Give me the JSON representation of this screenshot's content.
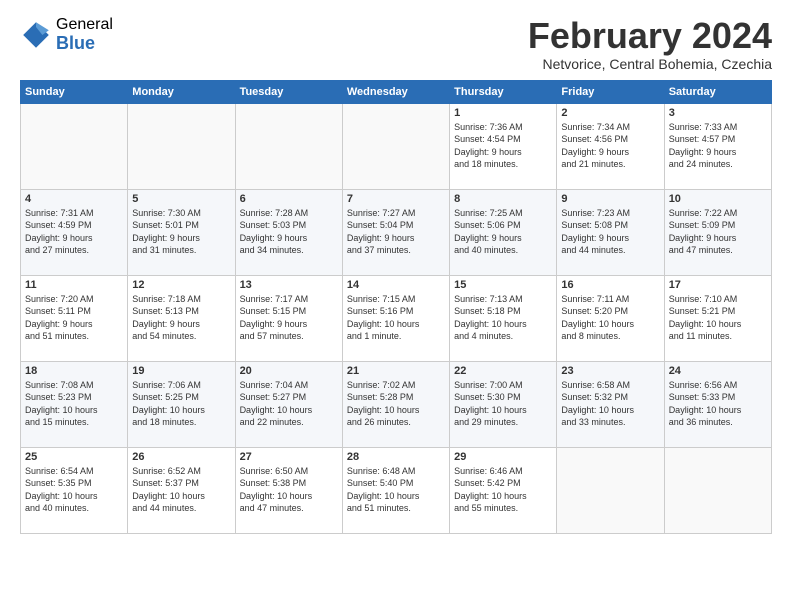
{
  "logo": {
    "general": "General",
    "blue": "Blue"
  },
  "title": "February 2024",
  "subtitle": "Netvorice, Central Bohemia, Czechia",
  "days_of_week": [
    "Sunday",
    "Monday",
    "Tuesday",
    "Wednesday",
    "Thursday",
    "Friday",
    "Saturday"
  ],
  "weeks": [
    [
      {
        "day": "",
        "content": ""
      },
      {
        "day": "",
        "content": ""
      },
      {
        "day": "",
        "content": ""
      },
      {
        "day": "",
        "content": ""
      },
      {
        "day": "1",
        "content": "Sunrise: 7:36 AM\nSunset: 4:54 PM\nDaylight: 9 hours\nand 18 minutes."
      },
      {
        "day": "2",
        "content": "Sunrise: 7:34 AM\nSunset: 4:56 PM\nDaylight: 9 hours\nand 21 minutes."
      },
      {
        "day": "3",
        "content": "Sunrise: 7:33 AM\nSunset: 4:57 PM\nDaylight: 9 hours\nand 24 minutes."
      }
    ],
    [
      {
        "day": "4",
        "content": "Sunrise: 7:31 AM\nSunset: 4:59 PM\nDaylight: 9 hours\nand 27 minutes."
      },
      {
        "day": "5",
        "content": "Sunrise: 7:30 AM\nSunset: 5:01 PM\nDaylight: 9 hours\nand 31 minutes."
      },
      {
        "day": "6",
        "content": "Sunrise: 7:28 AM\nSunset: 5:03 PM\nDaylight: 9 hours\nand 34 minutes."
      },
      {
        "day": "7",
        "content": "Sunrise: 7:27 AM\nSunset: 5:04 PM\nDaylight: 9 hours\nand 37 minutes."
      },
      {
        "day": "8",
        "content": "Sunrise: 7:25 AM\nSunset: 5:06 PM\nDaylight: 9 hours\nand 40 minutes."
      },
      {
        "day": "9",
        "content": "Sunrise: 7:23 AM\nSunset: 5:08 PM\nDaylight: 9 hours\nand 44 minutes."
      },
      {
        "day": "10",
        "content": "Sunrise: 7:22 AM\nSunset: 5:09 PM\nDaylight: 9 hours\nand 47 minutes."
      }
    ],
    [
      {
        "day": "11",
        "content": "Sunrise: 7:20 AM\nSunset: 5:11 PM\nDaylight: 9 hours\nand 51 minutes."
      },
      {
        "day": "12",
        "content": "Sunrise: 7:18 AM\nSunset: 5:13 PM\nDaylight: 9 hours\nand 54 minutes."
      },
      {
        "day": "13",
        "content": "Sunrise: 7:17 AM\nSunset: 5:15 PM\nDaylight: 9 hours\nand 57 minutes."
      },
      {
        "day": "14",
        "content": "Sunrise: 7:15 AM\nSunset: 5:16 PM\nDaylight: 10 hours\nand 1 minute."
      },
      {
        "day": "15",
        "content": "Sunrise: 7:13 AM\nSunset: 5:18 PM\nDaylight: 10 hours\nand 4 minutes."
      },
      {
        "day": "16",
        "content": "Sunrise: 7:11 AM\nSunset: 5:20 PM\nDaylight: 10 hours\nand 8 minutes."
      },
      {
        "day": "17",
        "content": "Sunrise: 7:10 AM\nSunset: 5:21 PM\nDaylight: 10 hours\nand 11 minutes."
      }
    ],
    [
      {
        "day": "18",
        "content": "Sunrise: 7:08 AM\nSunset: 5:23 PM\nDaylight: 10 hours\nand 15 minutes."
      },
      {
        "day": "19",
        "content": "Sunrise: 7:06 AM\nSunset: 5:25 PM\nDaylight: 10 hours\nand 18 minutes."
      },
      {
        "day": "20",
        "content": "Sunrise: 7:04 AM\nSunset: 5:27 PM\nDaylight: 10 hours\nand 22 minutes."
      },
      {
        "day": "21",
        "content": "Sunrise: 7:02 AM\nSunset: 5:28 PM\nDaylight: 10 hours\nand 26 minutes."
      },
      {
        "day": "22",
        "content": "Sunrise: 7:00 AM\nSunset: 5:30 PM\nDaylight: 10 hours\nand 29 minutes."
      },
      {
        "day": "23",
        "content": "Sunrise: 6:58 AM\nSunset: 5:32 PM\nDaylight: 10 hours\nand 33 minutes."
      },
      {
        "day": "24",
        "content": "Sunrise: 6:56 AM\nSunset: 5:33 PM\nDaylight: 10 hours\nand 36 minutes."
      }
    ],
    [
      {
        "day": "25",
        "content": "Sunrise: 6:54 AM\nSunset: 5:35 PM\nDaylight: 10 hours\nand 40 minutes."
      },
      {
        "day": "26",
        "content": "Sunrise: 6:52 AM\nSunset: 5:37 PM\nDaylight: 10 hours\nand 44 minutes."
      },
      {
        "day": "27",
        "content": "Sunrise: 6:50 AM\nSunset: 5:38 PM\nDaylight: 10 hours\nand 47 minutes."
      },
      {
        "day": "28",
        "content": "Sunrise: 6:48 AM\nSunset: 5:40 PM\nDaylight: 10 hours\nand 51 minutes."
      },
      {
        "day": "29",
        "content": "Sunrise: 6:46 AM\nSunset: 5:42 PM\nDaylight: 10 hours\nand 55 minutes."
      },
      {
        "day": "",
        "content": ""
      },
      {
        "day": "",
        "content": ""
      }
    ]
  ]
}
